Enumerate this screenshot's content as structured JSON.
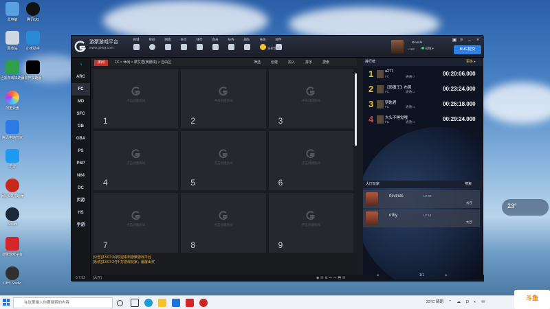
{
  "desktop": {
    "icons": [
      {
        "label": "此电脑",
        "color": "#5aa0e0"
      },
      {
        "label": "腾讯QQ",
        "color": "#111111"
      },
      {
        "label": "回收站",
        "color": "#cfd8e2"
      },
      {
        "label": "小米助手",
        "color": "#2a8ad6"
      },
      {
        "label": "迅雷游戏加速器",
        "color": "#2ea04a"
      },
      {
        "label": "雷神加速器",
        "color": "#000000"
      },
      {
        "label": "阿里云盘",
        "color": "#ff6a3a"
      },
      {
        "label": "腾讯电脑管家",
        "color": "#2c7ae6"
      },
      {
        "label": "迅雷",
        "color": "#1e9af0"
      },
      {
        "label": "网易UU加速器",
        "color": "#c8281e"
      },
      {
        "label": "Steam",
        "color": "#1b2838"
      },
      {
        "label": "游聚游戏平台",
        "color": "#d4262a"
      },
      {
        "label": "OBS Studio",
        "color": "#303030"
      }
    ]
  },
  "app": {
    "brand": {
      "title": "游聚游戏平台",
      "url": "www.gotvg.com"
    },
    "topnav": [
      "商城",
      "空间",
      "回放",
      "主页",
      "排行",
      "会员",
      "任务",
      "战队",
      "充值",
      "邮件"
    ],
    "notice_label": "游聚客服",
    "user": {
      "name": "Bovnda",
      "level": "Lv68",
      "status": "在线"
    },
    "bug_button": "BUG提交",
    "sidebar": [
      "ARC",
      "FC",
      "MD",
      "SFC",
      "GB",
      "GBA",
      "PS",
      "PSP",
      "N64",
      "DC",
      "页游",
      "HS",
      "手游"
    ],
    "version": "0.7.52",
    "breadcrumb": {
      "tag": "房间",
      "path": "FC > 休闲 > 摩艾君(黄赌琪) > 自由区",
      "actions": [
        "筛选",
        "创建",
        "加入",
        "排序",
        "搜索"
      ]
    },
    "room_hint": "点击创建房间",
    "rooms": [
      "1",
      "2",
      "3",
      "4",
      "5",
      "6",
      "7",
      "8",
      "9"
    ],
    "log": [
      "[公告][13:07:34]欢迎来到游聚游戏平台",
      "[系统][13:07:34]千万游戏玩家，屡屡出奖"
    ],
    "chat_placeholder": "[大厅]",
    "ranking": {
      "title": "排行榜",
      "more": "更多 ▸",
      "entries": [
        {
          "rank": "1",
          "name": "a277",
          "platform": "FC",
          "meta": "通通 0",
          "time": "00:20:06.000",
          "color": "#f2c230"
        },
        {
          "rank": "2",
          "name": "【邪魔王】布恩",
          "platform": "FC",
          "meta": "通通 0",
          "time": "00:23:24.000",
          "color": "#f2c230"
        },
        {
          "rank": "3",
          "name": "钥匙君",
          "platform": "FC",
          "meta": "通通 0",
          "time": "00:26:18.000",
          "color": "#f2c230"
        },
        {
          "rank": "4",
          "name": "大头不睡觉哦",
          "platform": "FC",
          "meta": "通通 0",
          "time": "00:29:24.000",
          "color": "#e23a3a"
        }
      ]
    },
    "lobby": {
      "title": "大厅玩家",
      "search": "搜索",
      "players": [
        {
          "name": "ftcvtnds",
          "level": "LV 60",
          "state": "大厅"
        },
        {
          "name": "rrtby",
          "level": "LV 14",
          "state": "大厅"
        }
      ],
      "page": "1/1"
    }
  },
  "taskbar": {
    "search_placeholder": "在这里输入你要搜索的内容",
    "weather": "23°C 晴朗",
    "temp_widget": "23°"
  },
  "watermark": "斗鱼"
}
